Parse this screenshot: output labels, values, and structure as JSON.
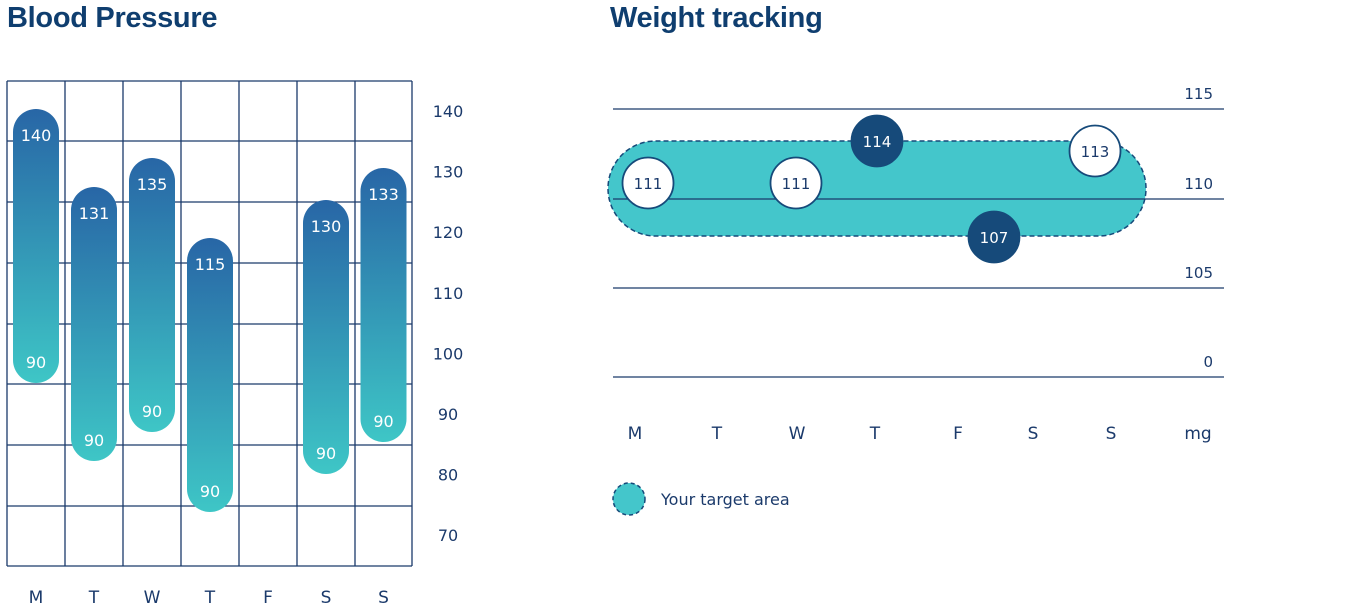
{
  "chart_data": [
    {
      "type": "bar",
      "title": "Blood Pressure",
      "categories": [
        "M",
        "T",
        "W",
        "T",
        "F",
        "S",
        "S"
      ],
      "series": [
        {
          "values": [
            140,
            131,
            135,
            115,
            null,
            130,
            133
          ]
        },
        {
          "values": [
            90,
            90,
            90,
            90,
            null,
            90,
            90
          ]
        }
      ],
      "y_ticks": [
        "140",
        "130",
        "120",
        "110",
        "100",
        "90",
        "80",
        "70"
      ],
      "ylim": [
        65,
        145
      ],
      "grid": true,
      "colors": {
        "top": "#2866a6",
        "bottom": "#3ec6c6",
        "grid": "#1b3a6b"
      }
    },
    {
      "type": "scatter",
      "title": "Weight tracking",
      "categories": [
        "M",
        "T",
        "W",
        "T",
        "F",
        "S",
        "S"
      ],
      "unit_label": "mg",
      "points": [
        {
          "day": "M",
          "value": 111,
          "style": "within"
        },
        {
          "day": "W",
          "value": 111,
          "style": "within"
        },
        {
          "day": "T",
          "value": 114,
          "style": "outside"
        },
        {
          "day": "F",
          "value": 107,
          "style": "outside"
        },
        {
          "day": "S",
          "value": 113,
          "style": "within"
        }
      ],
      "y_ticks": [
        "115",
        "110",
        "105",
        "0"
      ],
      "target_area": {
        "min": 108,
        "max": 113
      },
      "legend": {
        "label": "Your target area",
        "placement": "bottom-left"
      },
      "grid": true,
      "colors": {
        "target": "#44c6cb",
        "dark": "#164a7a",
        "line": "#1b3a6b"
      }
    }
  ]
}
